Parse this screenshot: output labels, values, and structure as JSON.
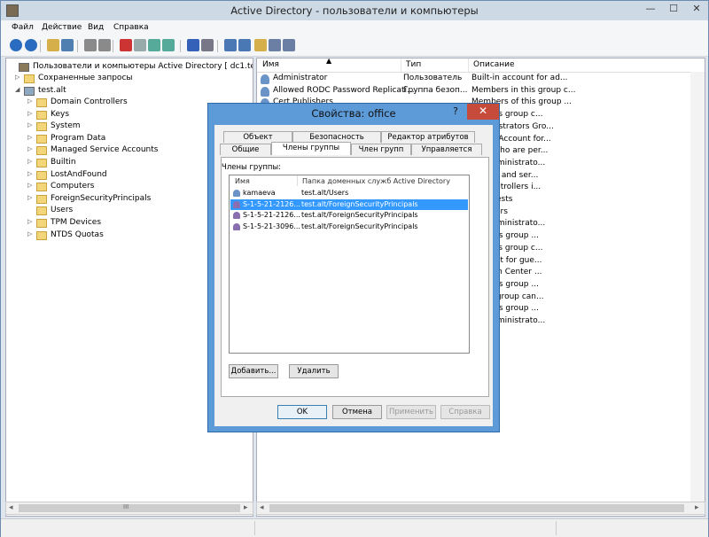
{
  "window": {
    "title": "Active Directory - пользователи и компьютеры",
    "minimize": "—",
    "maximize": "☐",
    "close": "✕"
  },
  "menu": [
    "Файл",
    "Действие",
    "Вид",
    "Справка"
  ],
  "toolbar_icons": [
    "back-icon",
    "forward-icon",
    "folder-up-icon",
    "show-tree-icon",
    "cut-icon",
    "copy-icon",
    "delete-icon",
    "properties-icon",
    "refresh-icon",
    "export-icon",
    "help-icon",
    "console-icon",
    "add-user-icon",
    "add-group-icon",
    "add-ou-icon",
    "filter-icon",
    "find-icon"
  ],
  "tree": {
    "root": "Пользователи и компьютеры Active Directory [ dc1.test.alt ]",
    "saved_queries": "Сохраненные запросы",
    "domain": "test.alt",
    "items": [
      "Domain Controllers",
      "Keys",
      "System",
      "Program Data",
      "Managed Service Accounts",
      "Builtin",
      "LostAndFound",
      "Computers",
      "ForeignSecurityPrincipals",
      "Users",
      "TPM Devices",
      "NTDS Quotas"
    ]
  },
  "list": {
    "headers": [
      "Имя",
      "Тип",
      "Описание"
    ],
    "rows": [
      {
        "name": "Administrator",
        "type": "Пользователь",
        "desc": "Built-in account for ad..."
      },
      {
        "name": "Allowed RODC Password Replicati...",
        "type": "Группа безоп...",
        "desc": "Members in this group c..."
      },
      {
        "name": "Cert Publishers",
        "type": "",
        "desc": "Members of this group ..."
      },
      {
        "name": "",
        "type": "",
        "desc": "s in this group c..."
      },
      {
        "name": "",
        "type": "",
        "desc": "administrators Gro..."
      },
      {
        "name": "",
        "type": "",
        "desc": "ervice Account for..."
      },
      {
        "name": "",
        "type": "",
        "desc": "ients who are per..."
      },
      {
        "name": "",
        "type": "",
        "desc": "ted administrato..."
      },
      {
        "name": "",
        "type": "",
        "desc": "tations and ser..."
      },
      {
        "name": "",
        "type": "",
        "desc": "ain controllers i..."
      },
      {
        "name": "",
        "type": "",
        "desc": "ain guests"
      },
      {
        "name": "",
        "type": "",
        "desc": "ain users"
      },
      {
        "name": "",
        "type": "",
        "desc": "ted administrato..."
      },
      {
        "name": "",
        "type": "",
        "desc": "s of this group ..."
      },
      {
        "name": "",
        "type": "",
        "desc": "s in this group c..."
      },
      {
        "name": "",
        "type": "",
        "desc": "account for gue..."
      },
      {
        "name": "",
        "type": "",
        "desc": "ribution Center ..."
      },
      {
        "name": "",
        "type": "",
        "desc": "s of this group ..."
      },
      {
        "name": "",
        "type": "",
        "desc": "n this group can..."
      },
      {
        "name": "",
        "type": "",
        "desc": "s of this group ..."
      },
      {
        "name": "",
        "type": "",
        "desc": "ted administrato..."
      }
    ]
  },
  "dialog": {
    "title": "Свойства: office",
    "help": "?",
    "close": "✕",
    "tabs_top": [
      "Объект",
      "Безопасность",
      "Редактор атрибутов"
    ],
    "tabs_bottom": [
      "Общие",
      "Члены группы",
      "Член групп",
      "Управляется"
    ],
    "members_label": "Члены группы:",
    "members_headers": [
      "Имя",
      "Папка доменных служб Active Directory"
    ],
    "members": [
      {
        "name": "kamaeva",
        "folder": "test.alt/Users",
        "selected": false
      },
      {
        "name": "S-1-5-21-2126...",
        "folder": "test.alt/ForeignSecurityPrincipals",
        "selected": true
      },
      {
        "name": "S-1-5-21-2126...",
        "folder": "test.alt/ForeignSecurityPrincipals",
        "selected": false
      },
      {
        "name": "S-1-5-21-3096...",
        "folder": "test.alt/ForeignSecurityPrincipals",
        "selected": false
      }
    ],
    "add_button": "Добавить...",
    "remove_button": "Удалить",
    "ok": "OK",
    "cancel": "Отмена",
    "apply": "Применить",
    "help_button": "Справка"
  },
  "scroll": {
    "left_arrow": "◂",
    "right_arrow": "▸",
    "up_arrow": "▴",
    "down_arrow": "▾",
    "thumb_grip": "III"
  },
  "colors": {
    "accent": "#5d9ad8",
    "selection": "#3399ff",
    "close_red": "#c74b3a"
  }
}
